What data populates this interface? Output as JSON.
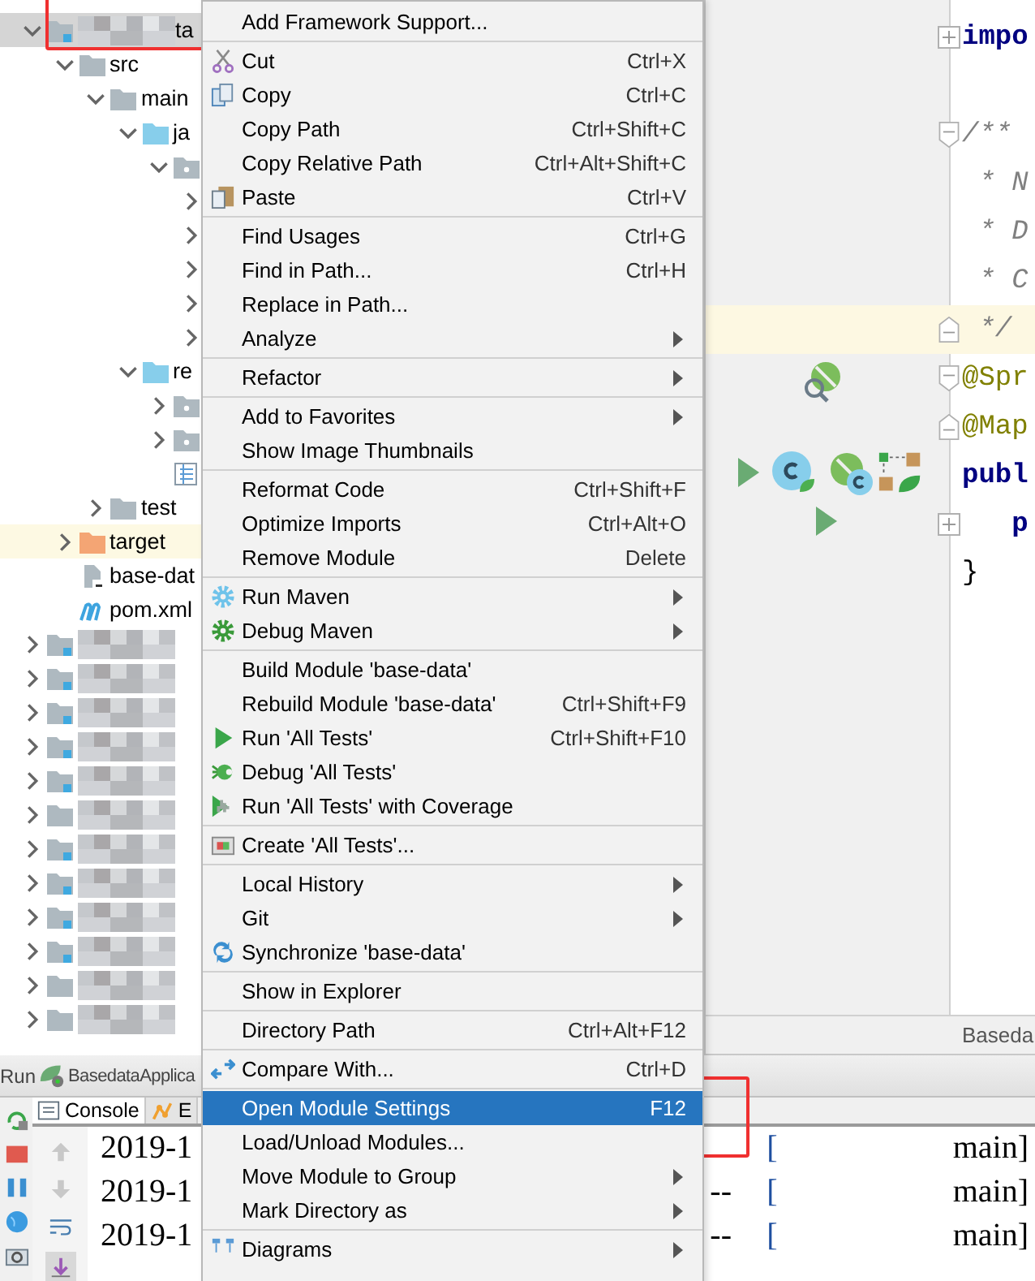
{
  "tree": [
    {
      "label": "ta",
      "redacted": true,
      "expanded": true,
      "selected": true,
      "kind": "module",
      "children": [
        {
          "label": "src",
          "expanded": true,
          "kind": "folder",
          "children": [
            {
              "label": "main",
              "expanded": true,
              "kind": "folder",
              "children": [
                {
                  "label": "ja",
                  "expanded": true,
                  "kind": "source",
                  "children": [
                    {
                      "expanded": true,
                      "kind": "package",
                      "children": [
                        {
                          "expanded": false
                        },
                        {
                          "expanded": false
                        },
                        {
                          "expanded": false
                        },
                        {
                          "expanded": false
                        },
                        {
                          "expanded": false
                        }
                      ]
                    }
                  ]
                },
                {
                  "label": "re",
                  "expanded": true,
                  "kind": "source",
                  "children": [
                    {
                      "expanded": false,
                      "kind": "package"
                    },
                    {
                      "expanded": false,
                      "kind": "package"
                    },
                    {
                      "kind": "properties"
                    }
                  ]
                }
              ]
            },
            {
              "label": "test",
              "expanded": false,
              "kind": "folder"
            }
          ]
        },
        {
          "label": "target",
          "expanded": false,
          "kind": "excluded",
          "highlighted": true
        },
        {
          "label": "base-dat",
          "kind": "iml"
        },
        {
          "label": "pom.xml",
          "kind": "maven"
        }
      ]
    },
    {
      "redacted": true,
      "expanded": false,
      "kind": "module"
    },
    {
      "redacted": true,
      "expanded": false,
      "kind": "module"
    },
    {
      "redacted": true,
      "expanded": false,
      "kind": "module"
    },
    {
      "redacted": true,
      "expanded": false,
      "kind": "module"
    },
    {
      "redacted": true,
      "expanded": false,
      "kind": "module"
    },
    {
      "redacted": true,
      "expanded": false,
      "kind": "folder"
    },
    {
      "redacted": true,
      "expanded": false,
      "kind": "module"
    },
    {
      "redacted": true,
      "expanded": false,
      "kind": "module"
    },
    {
      "redacted": true,
      "expanded": false,
      "kind": "module"
    },
    {
      "redacted": true,
      "expanded": false,
      "kind": "module"
    },
    {
      "redacted": true,
      "expanded": false,
      "kind": "folder"
    },
    {
      "redacted": true,
      "expanded": false,
      "kind": "folder"
    }
  ],
  "editor": {
    "lines": [
      {
        "kind": "keyword",
        "text": "impo",
        "collapsed": true,
        "fold_start": false,
        "fold_end": false,
        "current": false
      },
      {
        "kind": "blank",
        "collapsed": false,
        "fold_start": false,
        "fold_end": false,
        "current": false
      },
      {
        "kind": "comment",
        "text": "/**",
        "collapsed": false,
        "fold_start": true,
        "fold_end": false,
        "current": false
      },
      {
        "kind": "comment",
        "text": " * N",
        "collapsed": false,
        "fold_start": false,
        "fold_end": false,
        "current": false
      },
      {
        "kind": "comment",
        "text": " * D",
        "collapsed": false,
        "fold_start": false,
        "fold_end": false,
        "current": false
      },
      {
        "kind": "comment",
        "text": " * C",
        "collapsed": false,
        "fold_start": false,
        "fold_end": false,
        "current": false
      },
      {
        "kind": "comment",
        "text": " */",
        "collapsed": false,
        "fold_start": false,
        "fold_end": true,
        "current": true
      },
      {
        "kind": "annotation",
        "text": "@Spr",
        "collapsed": false,
        "fold_start": true,
        "fold_end": false,
        "current": false
      },
      {
        "kind": "annotation",
        "text": "@Map",
        "collapsed": false,
        "fold_start": false,
        "fold_end": true,
        "current": false
      },
      {
        "kind": "keyword",
        "text": "publ",
        "collapsed": false,
        "fold_start": false,
        "fold_end": false,
        "current": false
      },
      {
        "kind": "keyword",
        "text": "   p",
        "collapsed": true,
        "fold_start": false,
        "fold_end": false,
        "current": false
      },
      {
        "kind": "brace",
        "text": "}",
        "collapsed": false,
        "fold_start": false,
        "fold_end": false,
        "current": false
      }
    ],
    "breadcrumb": "Baseda"
  },
  "run_bar": {
    "label": "Run",
    "config": "BasedataApplica"
  },
  "console": {
    "tabs": [
      {
        "label": "Console",
        "selected": true
      },
      {
        "label": "E",
        "selected": false
      }
    ],
    "rows": [
      {
        "time": "2019-1",
        "bracket": "[",
        "thread": "main]"
      },
      {
        "time": "2019-1",
        "dashes": "--",
        "bracket": "[",
        "thread": "main]"
      },
      {
        "time": "2019-1",
        "dashes": "--",
        "bracket": "[",
        "thread": "main]"
      }
    ]
  },
  "context_menu": [
    {
      "kind": "plain",
      "label": "Add Framework Support...",
      "selected": false
    },
    {
      "kind": "separator"
    },
    {
      "kind": "scissors",
      "label": "Cut",
      "shortcut": "Ctrl+X",
      "selected": false
    },
    {
      "kind": "copy",
      "label": "Copy",
      "shortcut": "Ctrl+C",
      "selected": false
    },
    {
      "kind": "plain",
      "label": "Copy Path",
      "shortcut": "Ctrl+Shift+C",
      "selected": false
    },
    {
      "kind": "plain",
      "label": "Copy Relative Path",
      "shortcut": "Ctrl+Alt+Shift+C",
      "selected": false
    },
    {
      "kind": "paste",
      "label": "Paste",
      "shortcut": "Ctrl+V",
      "selected": false
    },
    {
      "kind": "separator"
    },
    {
      "kind": "plain",
      "label": "Find Usages",
      "shortcut": "Ctrl+G",
      "selected": false
    },
    {
      "kind": "plain",
      "label": "Find in Path...",
      "shortcut": "Ctrl+H",
      "selected": false
    },
    {
      "kind": "plain",
      "label": "Replace in Path...",
      "selected": false
    },
    {
      "kind": "plain",
      "label": "Analyze",
      "submenu": true,
      "selected": false
    },
    {
      "kind": "separator"
    },
    {
      "kind": "plain",
      "label": "Refactor",
      "submenu": true,
      "selected": false
    },
    {
      "kind": "separator"
    },
    {
      "kind": "plain",
      "label": "Add to Favorites",
      "submenu": true,
      "selected": false
    },
    {
      "kind": "plain",
      "label": "Show Image Thumbnails",
      "selected": false
    },
    {
      "kind": "separator"
    },
    {
      "kind": "plain",
      "label": "Reformat Code",
      "shortcut": "Ctrl+Shift+F",
      "selected": false
    },
    {
      "kind": "plain",
      "label": "Optimize Imports",
      "shortcut": "Ctrl+Alt+O",
      "selected": false
    },
    {
      "kind": "plain",
      "label": "Remove Module",
      "shortcut": "Delete",
      "selected": false
    },
    {
      "kind": "separator"
    },
    {
      "kind": "maven",
      "label": "Run Maven",
      "submenu": true,
      "selected": false
    },
    {
      "kind": "maven-debug",
      "label": "Debug Maven",
      "submenu": true,
      "selected": false
    },
    {
      "kind": "separator"
    },
    {
      "kind": "plain",
      "label": "Build Module 'base-data'",
      "selected": false
    },
    {
      "kind": "plain",
      "label": "Rebuild Module 'base-data'",
      "shortcut": "Ctrl+Shift+F9",
      "selected": false
    },
    {
      "kind": "run",
      "label": "Run 'All Tests'",
      "shortcut": "Ctrl+Shift+F10",
      "selected": false
    },
    {
      "kind": "debug",
      "label": "Debug 'All Tests'",
      "selected": false
    },
    {
      "kind": "coverage",
      "label": "Run 'All Tests' with Coverage",
      "selected": false
    },
    {
      "kind": "separator"
    },
    {
      "kind": "test",
      "label": "Create 'All Tests'...",
      "selected": false
    },
    {
      "kind": "separator"
    },
    {
      "kind": "plain",
      "label": "Local History",
      "submenu": true,
      "selected": false
    },
    {
      "kind": "plain",
      "label": "Git",
      "submenu": true,
      "selected": false
    },
    {
      "kind": "sync",
      "label": "Synchronize 'base-data'",
      "selected": false
    },
    {
      "kind": "separator"
    },
    {
      "kind": "plain",
      "label": "Show in Explorer",
      "selected": false
    },
    {
      "kind": "separator"
    },
    {
      "kind": "plain",
      "label": "Directory Path",
      "shortcut": "Ctrl+Alt+F12",
      "selected": false
    },
    {
      "kind": "separator"
    },
    {
      "kind": "compare",
      "label": "Compare With...",
      "shortcut": "Ctrl+D",
      "selected": false
    },
    {
      "kind": "separator"
    },
    {
      "kind": "plain",
      "label": "Open Module Settings",
      "shortcut": "F12",
      "selected": true
    },
    {
      "kind": "plain",
      "label": "Load/Unload Modules...",
      "selected": false
    },
    {
      "kind": "plain",
      "label": "Move Module to Group",
      "submenu": true,
      "selected": false
    },
    {
      "kind": "plain",
      "label": "Mark Directory as",
      "submenu": true,
      "selected": false
    },
    {
      "kind": "separator"
    },
    {
      "kind": "diagram",
      "label": "Diagrams",
      "submenu": true,
      "selected": false
    }
  ]
}
